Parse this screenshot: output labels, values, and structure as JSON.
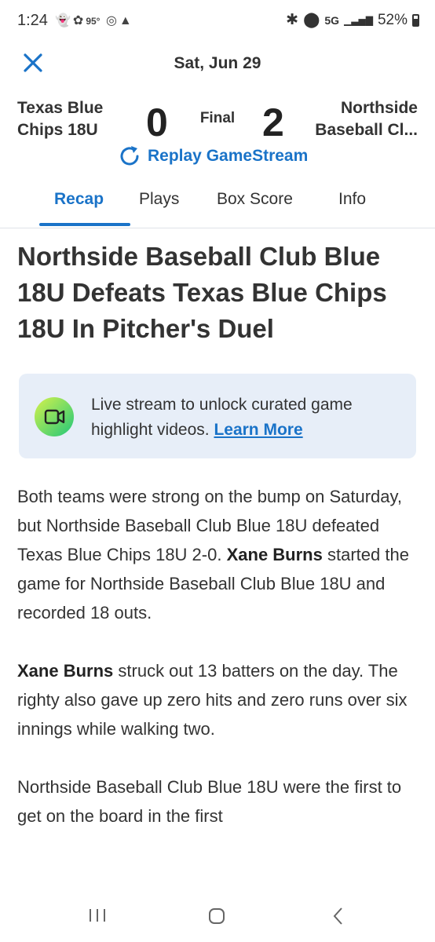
{
  "status_bar": {
    "time": "1:24",
    "temperature": "95°",
    "network": "5G",
    "battery": "52%"
  },
  "header": {
    "date": "Sat, Jun 29"
  },
  "game": {
    "team_left": "Texas Blue Chips 18U",
    "score_left": "0",
    "status": "Final",
    "score_right": "2",
    "team_right": "Northside Baseball Cl...",
    "replay_label": "Replay GameStream"
  },
  "tabs": [
    {
      "label": "Recap",
      "active": true
    },
    {
      "label": "Plays",
      "active": false
    },
    {
      "label": "Box Score",
      "active": false
    },
    {
      "label": "Info",
      "active": false
    }
  ],
  "article": {
    "headline": "Northside Baseball Club Blue 18U Defeats Texas Blue Chips 18U In Pitcher's Duel",
    "banner": {
      "text": "Live stream to unlock curated game highlight videos.",
      "link": "Learn More"
    },
    "p1_text": "Both teams were strong on the bump on Saturday, but Northside Baseball Club Blue 18U defeated Texas Blue Chips 18U 2-0.",
    "p1_name": "Xane Burns",
    "p1_rest": "started the game for Northside Baseball Club Blue 18U and recorded 18 outs.",
    "p2_name": "Xane Burns",
    "p2_rest": "struck out 13 batters on the day. The righty also gave up zero hits and zero runs over six innings while walking two.",
    "p3_text": "Northside Baseball Club Blue 18U were the first to get on the board in the first"
  },
  "colors": {
    "accent": "#1a73c8",
    "banner_bg": "#e7eef8",
    "text": "#333333"
  }
}
